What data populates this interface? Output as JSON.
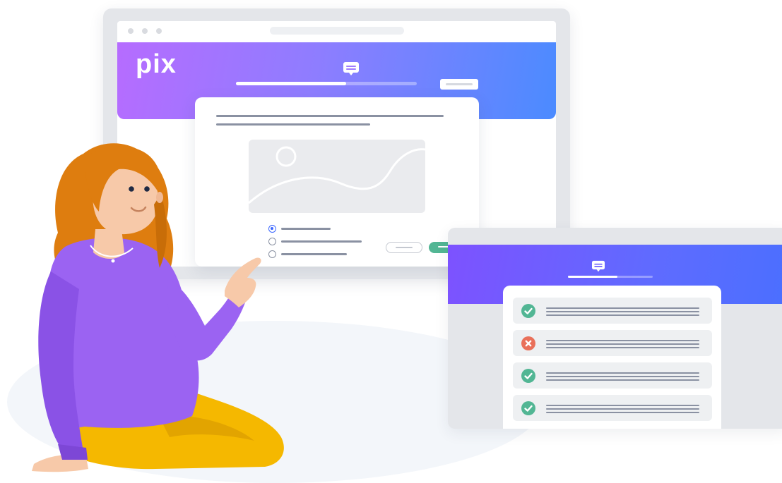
{
  "brand": {
    "logo_text": "pix"
  },
  "colors": {
    "hero_gradient": [
      "#b66cff",
      "#8e7dff",
      "#4b8bff"
    ],
    "results_gradient": [
      "#7d52ff",
      "#4b6fff"
    ],
    "primary_button": "#52b694",
    "selected_radio": "#3d68ff",
    "correct": "#52b694",
    "incorrect": "#e9705a",
    "shirt": "#9b63f2",
    "pants": "#f5b800",
    "hair": "#de7d0f"
  },
  "progress": {
    "main_fraction": 0.61,
    "results_fraction": 0.58
  },
  "question": {
    "options": [
      {
        "selected": true
      },
      {
        "selected": false
      },
      {
        "selected": false
      }
    ]
  },
  "results": [
    {
      "status": "correct",
      "icon": "check-icon"
    },
    {
      "status": "incorrect",
      "icon": "cross-icon"
    },
    {
      "status": "correct",
      "icon": "check-icon"
    },
    {
      "status": "correct",
      "icon": "check-icon"
    }
  ]
}
